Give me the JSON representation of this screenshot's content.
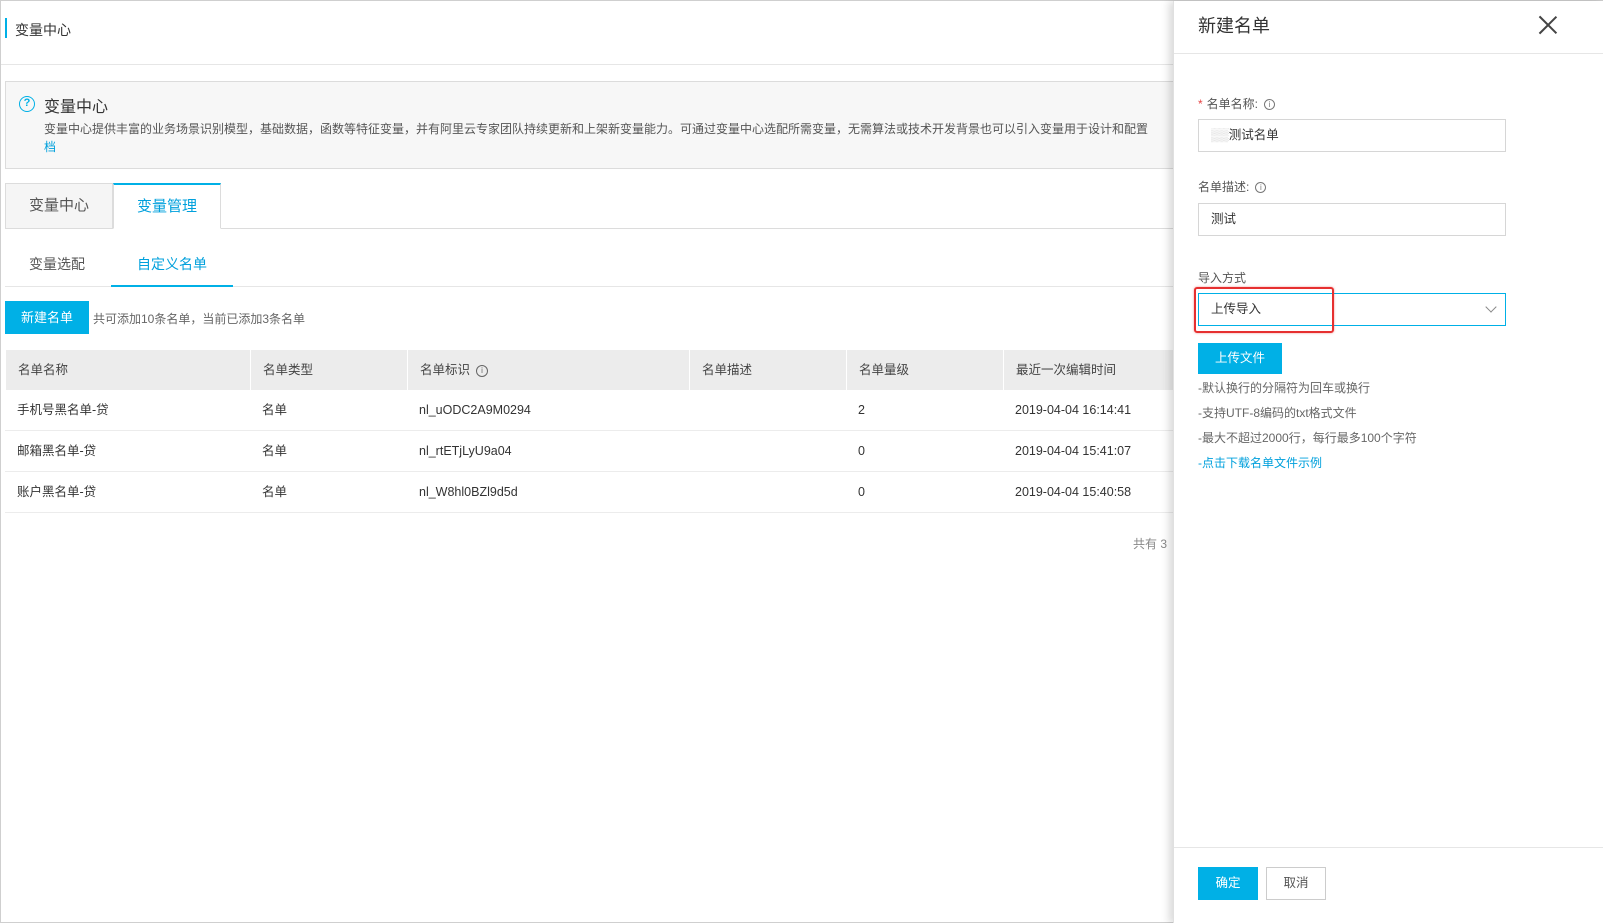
{
  "header": {
    "title": "变量中心"
  },
  "info": {
    "title": "变量中心",
    "text": "变量中心提供丰富的业务场景识别模型，基础数据，函数等特征变量，并有阿里云专家团队持续更新和上架新变量能力。可通过变量中心选配所需变量，无需算法或技术开发背景也可以引入变量用于设计和配置",
    "link": "档"
  },
  "main_tabs": [
    {
      "label": "变量中心"
    },
    {
      "label": "变量管理"
    }
  ],
  "sub_tabs": [
    {
      "label": "变量选配"
    },
    {
      "label": "自定义名单"
    }
  ],
  "toolbar": {
    "new_button": "新建名单",
    "quota": "共可添加10条名单，当前已添加3条名单"
  },
  "table": {
    "headers": [
      "名单名称",
      "名单类型",
      "名单标识",
      "名单描述",
      "名单量级",
      "最近一次编辑时间"
    ],
    "rows": [
      {
        "name": "手机号黑名单-贷",
        "type": "名单",
        "id": "nl_uODC2A9M0294",
        "desc": "",
        "count": "2",
        "time": "2019-04-04 16:14:41"
      },
      {
        "name": "邮箱黑名单-贷",
        "type": "名单",
        "id": "nl_rtETjLyU9a04",
        "desc": "",
        "count": "0",
        "time": "2019-04-04 15:41:07"
      },
      {
        "name": "账户黑名单-贷",
        "type": "名单",
        "id": "nl_W8hl0BZl9d5d",
        "desc": "",
        "count": "0",
        "time": "2019-04-04 15:40:58"
      }
    ]
  },
  "pager": {
    "text": "共有 3"
  },
  "drawer": {
    "title": "新建名单",
    "name_label": "名单名称:",
    "name_value": "测试名单",
    "desc_label": "名单描述:",
    "desc_value": "测试",
    "import_label": "导入方式",
    "import_value": "上传导入",
    "upload_button": "上传文件",
    "hints": [
      "-默认换行的分隔符为回车或换行",
      "-支持UTF-8编码的txt格式文件",
      "-最大不超过2000行，每行最多100个字符"
    ],
    "download_link": "-点击下载名单文件示例",
    "ok_button": "确定",
    "cancel_button": "取消"
  },
  "colors": {
    "accent": "#00b0e6",
    "highlight": "#e63030"
  }
}
